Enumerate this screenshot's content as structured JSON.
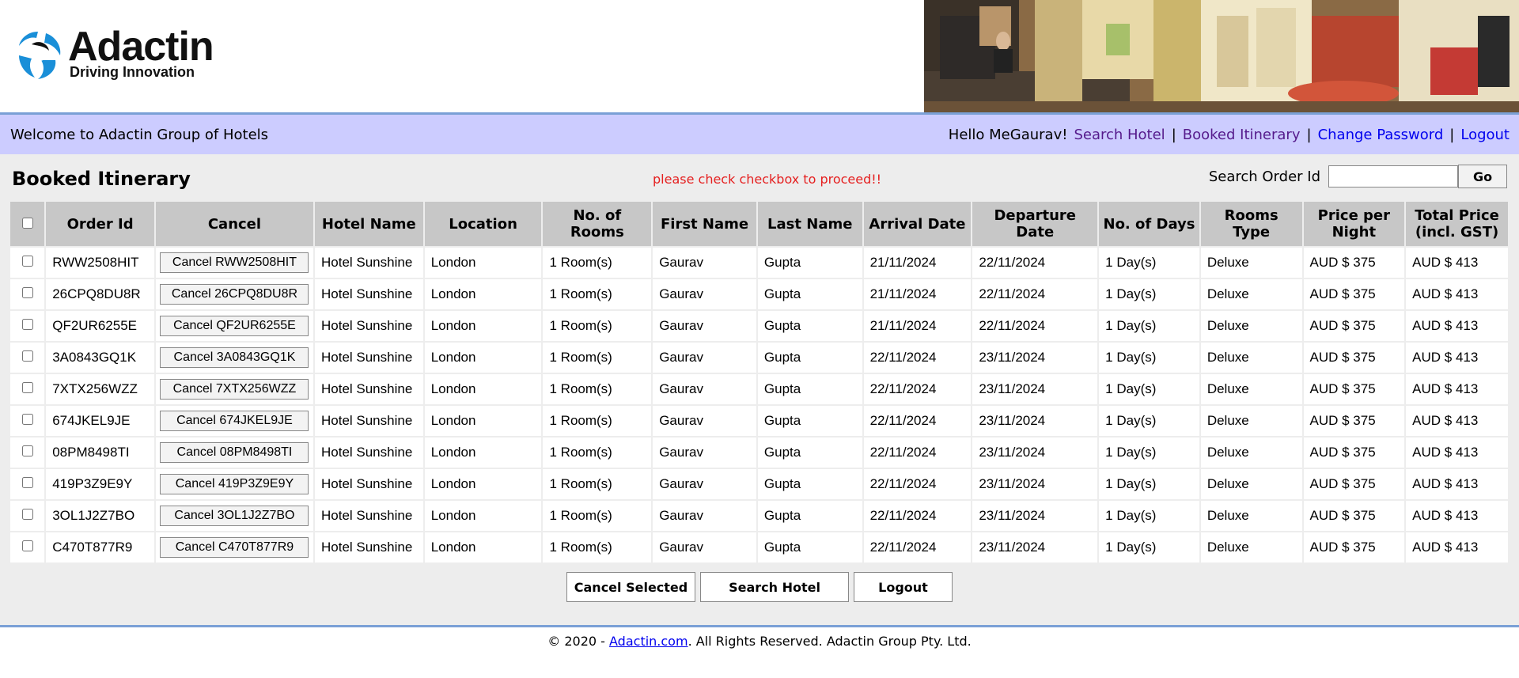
{
  "logo": {
    "title": "Adactin",
    "tagline": "Driving Innovation"
  },
  "nav": {
    "welcome": "Welcome to Adactin Group of Hotels",
    "hello": "Hello MeGaurav!",
    "links": [
      "Search Hotel",
      "Booked Itinerary",
      "Change Password",
      "Logout"
    ],
    "separator": "|"
  },
  "page": {
    "title": "Booked Itinerary",
    "error": "please check checkbox to proceed!!",
    "search_label": "Search Order Id",
    "search_value": "",
    "go_label": "Go"
  },
  "table": {
    "headers": [
      "Order Id",
      "Cancel",
      "Hotel Name",
      "Location",
      "No. of Rooms",
      "First Name",
      "Last Name",
      "Arrival Date",
      "Departure Date",
      "No. of Days",
      "Rooms Type",
      "Price per Night",
      "Total Price (incl. GST)"
    ],
    "rows": [
      {
        "order_id": "RWW2508HIT",
        "cancel": "Cancel RWW2508HIT",
        "hotel": "Hotel Sunshine",
        "location": "London",
        "rooms": "1 Room(s)",
        "first": "Gaurav",
        "last": "Gupta",
        "arrival": "21/11/2024",
        "departure": "22/11/2024",
        "days": "1 Day(s)",
        "type": "Deluxe",
        "price": "AUD $ 375",
        "total": "AUD $ 413"
      },
      {
        "order_id": "26CPQ8DU8R",
        "cancel": "Cancel 26CPQ8DU8R",
        "hotel": "Hotel Sunshine",
        "location": "London",
        "rooms": "1 Room(s)",
        "first": "Gaurav",
        "last": "Gupta",
        "arrival": "21/11/2024",
        "departure": "22/11/2024",
        "days": "1 Day(s)",
        "type": "Deluxe",
        "price": "AUD $ 375",
        "total": "AUD $ 413"
      },
      {
        "order_id": "QF2UR6255E",
        "cancel": "Cancel QF2UR6255E",
        "hotel": "Hotel Sunshine",
        "location": "London",
        "rooms": "1 Room(s)",
        "first": "Gaurav",
        "last": "Gupta",
        "arrival": "21/11/2024",
        "departure": "22/11/2024",
        "days": "1 Day(s)",
        "type": "Deluxe",
        "price": "AUD $ 375",
        "total": "AUD $ 413"
      },
      {
        "order_id": "3A0843GQ1K",
        "cancel": "Cancel 3A0843GQ1K",
        "hotel": "Hotel Sunshine",
        "location": "London",
        "rooms": "1 Room(s)",
        "first": "Gaurav",
        "last": "Gupta",
        "arrival": "22/11/2024",
        "departure": "23/11/2024",
        "days": "1 Day(s)",
        "type": "Deluxe",
        "price": "AUD $ 375",
        "total": "AUD $ 413"
      },
      {
        "order_id": "7XTX256WZZ",
        "cancel": "Cancel 7XTX256WZZ",
        "hotel": "Hotel Sunshine",
        "location": "London",
        "rooms": "1 Room(s)",
        "first": "Gaurav",
        "last": "Gupta",
        "arrival": "22/11/2024",
        "departure": "23/11/2024",
        "days": "1 Day(s)",
        "type": "Deluxe",
        "price": "AUD $ 375",
        "total": "AUD $ 413"
      },
      {
        "order_id": "674JKEL9JE",
        "cancel": "Cancel 674JKEL9JE",
        "hotel": "Hotel Sunshine",
        "location": "London",
        "rooms": "1 Room(s)",
        "first": "Gaurav",
        "last": "Gupta",
        "arrival": "22/11/2024",
        "departure": "23/11/2024",
        "days": "1 Day(s)",
        "type": "Deluxe",
        "price": "AUD $ 375",
        "total": "AUD $ 413"
      },
      {
        "order_id": "08PM8498TI",
        "cancel": "Cancel 08PM8498TI",
        "hotel": "Hotel Sunshine",
        "location": "London",
        "rooms": "1 Room(s)",
        "first": "Gaurav",
        "last": "Gupta",
        "arrival": "22/11/2024",
        "departure": "23/11/2024",
        "days": "1 Day(s)",
        "type": "Deluxe",
        "price": "AUD $ 375",
        "total": "AUD $ 413"
      },
      {
        "order_id": "419P3Z9E9Y",
        "cancel": "Cancel 419P3Z9E9Y",
        "hotel": "Hotel Sunshine",
        "location": "London",
        "rooms": "1 Room(s)",
        "first": "Gaurav",
        "last": "Gupta",
        "arrival": "22/11/2024",
        "departure": "23/11/2024",
        "days": "1 Day(s)",
        "type": "Deluxe",
        "price": "AUD $ 375",
        "total": "AUD $ 413"
      },
      {
        "order_id": "3OL1J2Z7BO",
        "cancel": "Cancel 3OL1J2Z7BO",
        "hotel": "Hotel Sunshine",
        "location": "London",
        "rooms": "1 Room(s)",
        "first": "Gaurav",
        "last": "Gupta",
        "arrival": "22/11/2024",
        "departure": "23/11/2024",
        "days": "1 Day(s)",
        "type": "Deluxe",
        "price": "AUD $ 375",
        "total": "AUD $ 413"
      },
      {
        "order_id": "C470T877R9",
        "cancel": "Cancel C470T877R9",
        "hotel": "Hotel Sunshine",
        "location": "London",
        "rooms": "1 Room(s)",
        "first": "Gaurav",
        "last": "Gupta",
        "arrival": "22/11/2024",
        "departure": "23/11/2024",
        "days": "1 Day(s)",
        "type": "Deluxe",
        "price": "AUD $ 375",
        "total": "AUD $ 413"
      }
    ]
  },
  "actions": [
    "Cancel Selected",
    "Search Hotel",
    "Logout"
  ],
  "footer": {
    "prefix": "© 2020 - ",
    "link": "Adactin.com",
    "suffix": ". All Rights Reserved. Adactin Group Pty. Ltd."
  },
  "colors": {
    "nav_bg": "#ccccff",
    "header_rule": "#7aa0d6",
    "error": "#e52020",
    "table_header": "#c7c7c7",
    "page_bg": "#ededed"
  }
}
